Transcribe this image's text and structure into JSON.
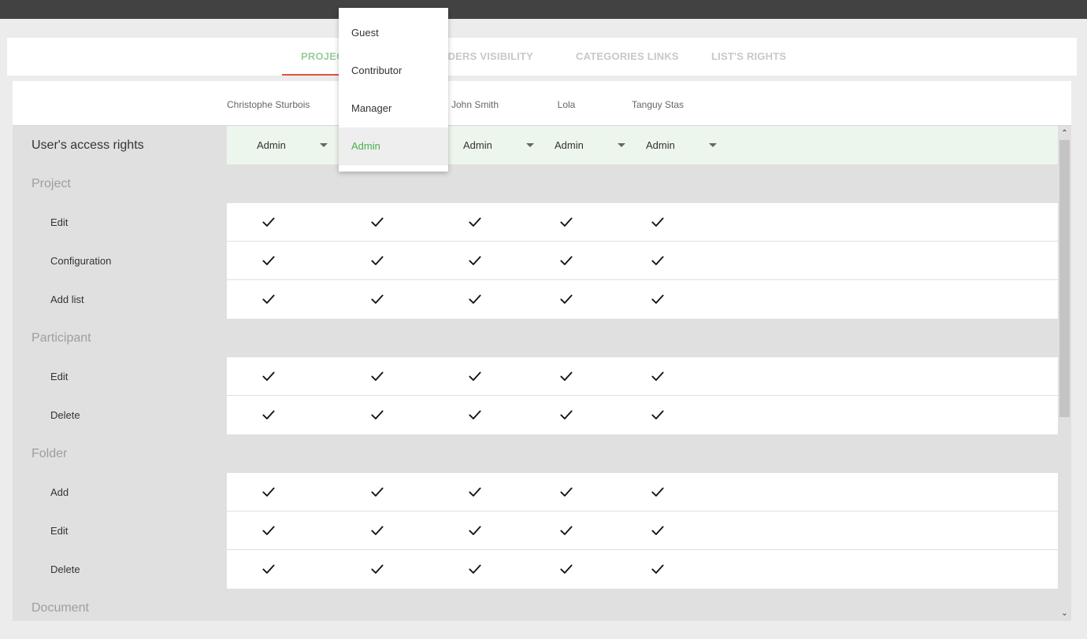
{
  "tabs": [
    {
      "label": "PROJECT",
      "active": true
    },
    {
      "label": "FOLDERS VISIBILITY",
      "active": false
    },
    {
      "label": "CATEGORIES LINKS",
      "active": false
    },
    {
      "label": "LIST'S RIGHTS",
      "active": false
    }
  ],
  "users": [
    "Christophe Sturbois",
    "",
    "John Smith",
    "Lola",
    "Tanguy Stas"
  ],
  "role_row": {
    "label": "User's access rights",
    "values": [
      "Admin",
      "",
      "Admin",
      "Admin",
      "Admin"
    ]
  },
  "sections": [
    {
      "title": "Project",
      "permissions": [
        "Edit",
        "Configuration",
        "Add list"
      ]
    },
    {
      "title": "Participant",
      "permissions": [
        "Edit",
        "Delete"
      ]
    },
    {
      "title": "Folder",
      "permissions": [
        "Add",
        "Edit",
        "Delete"
      ]
    },
    {
      "title": "Document",
      "permissions": []
    }
  ],
  "dropdown": {
    "options": [
      "Guest",
      "Contributor",
      "Manager",
      "Admin"
    ],
    "selected": "Admin"
  },
  "icons": {
    "check": "check-icon",
    "caret": "caret-down-icon",
    "scroll_up": "chevron-up-icon",
    "scroll_down": "chevron-down-icon"
  },
  "colors": {
    "accent": "#4caf50",
    "tab_active": "#9ccc9c",
    "tab_underline": "#e0533f",
    "role_row_bg": "#edf6ec"
  }
}
